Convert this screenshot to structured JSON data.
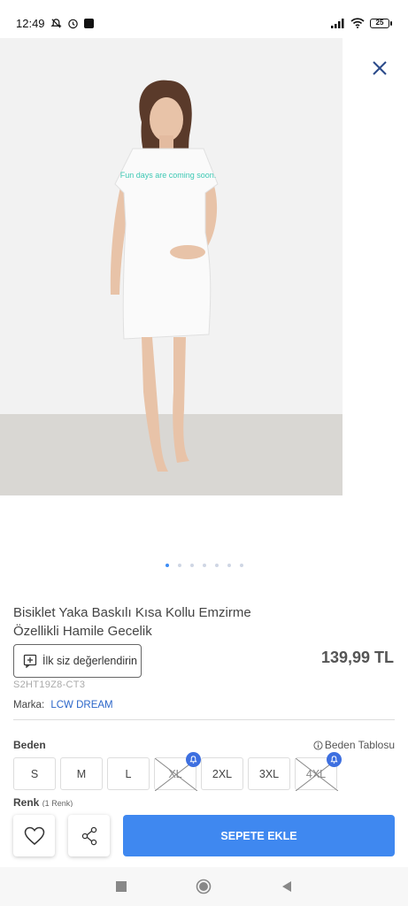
{
  "status_bar": {
    "time": "12:49",
    "battery": "25"
  },
  "product": {
    "title": "Bisiklet Yaka Baskılı Kısa Kollu Emzirme Özellikli Hamile Gecelik",
    "shirt_print": "Fun days are coming soon.",
    "price": "139,99 TL",
    "sku": "S2HT19Z8-CT3",
    "brand_label": "Marka:",
    "brand_name": "LCW DREAM"
  },
  "gallery": {
    "total_images": 7,
    "active_index": 0
  },
  "review_button": {
    "label": "İlk siz değerlendirin"
  },
  "size_section": {
    "label": "Beden",
    "size_table_label": "Beden Tablosu",
    "sizes": [
      {
        "label": "S",
        "available": true
      },
      {
        "label": "M",
        "available": true
      },
      {
        "label": "L",
        "available": true
      },
      {
        "label": "XL",
        "available": false
      },
      {
        "label": "2XL",
        "available": true
      },
      {
        "label": "3XL",
        "available": true
      },
      {
        "label": "4XL",
        "available": false
      }
    ]
  },
  "color_section": {
    "label": "Renk",
    "count": "(1 Renk)"
  },
  "action_bar": {
    "cart_label": "SEPETE EKLE"
  },
  "colors": {
    "accent": "#3f88f0",
    "brand_link": "#2b66c9",
    "notify_badge": "#3d6fe0"
  }
}
